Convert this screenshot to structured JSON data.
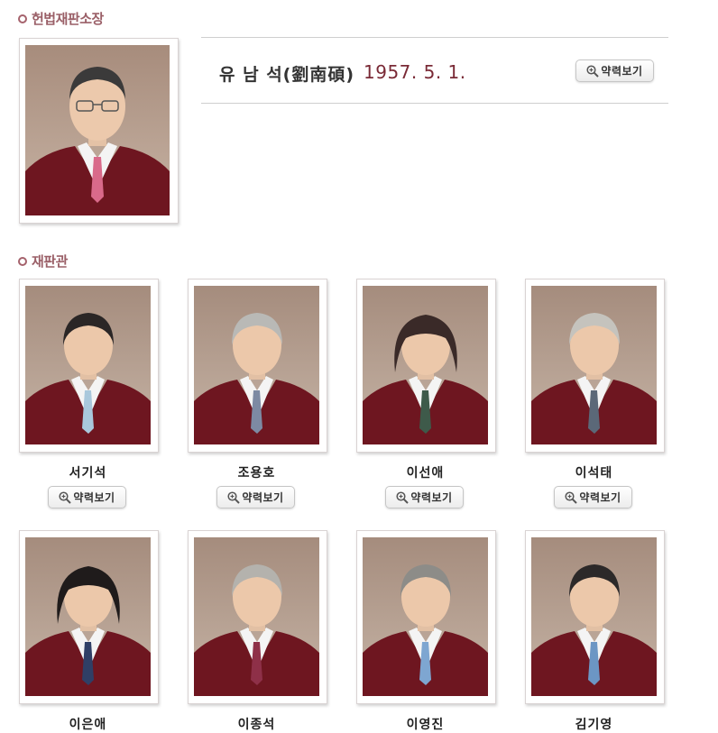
{
  "sections": {
    "chief_title": "헌법재판소장",
    "justices_title": "재판관"
  },
  "chief": {
    "name": "유 남 석(劉南碩)",
    "birth": "1957. 5. 1.",
    "button_label": "약력보기"
  },
  "justices": [
    {
      "name": "서기석",
      "button_label": "약력보기"
    },
    {
      "name": "조용호",
      "button_label": "약력보기"
    },
    {
      "name": "이선애",
      "button_label": "약력보기"
    },
    {
      "name": "이석태",
      "button_label": "약력보기"
    },
    {
      "name": "이은애"
    },
    {
      "name": "이종석"
    },
    {
      "name": "이영진"
    },
    {
      "name": "김기영"
    }
  ],
  "colors": {
    "accent": "#9a5f67",
    "robe": "#6e1620",
    "date": "#7a2a36"
  },
  "icons": {
    "view_button": "zoom-in-icon"
  }
}
